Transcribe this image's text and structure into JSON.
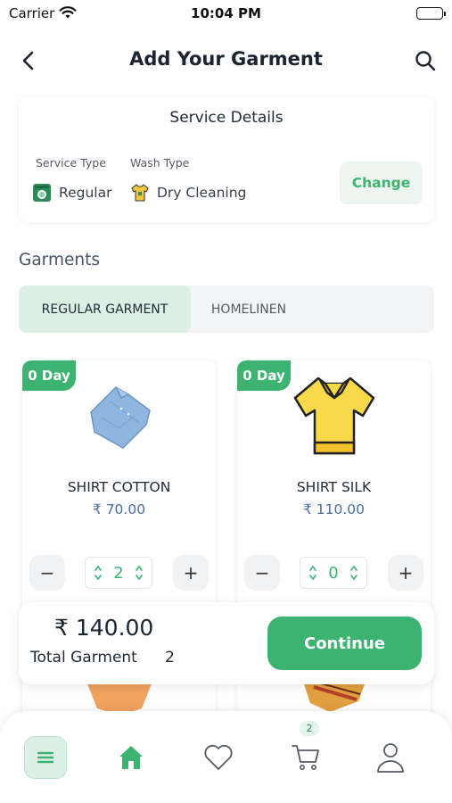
{
  "status_bar": {
    "carrier": "Carrier",
    "time": "10:04 PM"
  },
  "header": {
    "title": "Add Your Garment"
  },
  "service_details": {
    "title": "Service Details",
    "service_type_label": "Service Type",
    "service_type_value": "Regular",
    "wash_type_label": "Wash Type",
    "wash_type_value": "Dry Cleaning",
    "change_label": "Change"
  },
  "garments": {
    "section_title": "Garments",
    "tabs": [
      {
        "label": "REGULAR GARMENT",
        "active": true
      },
      {
        "label": "HOMELINEN",
        "active": false
      }
    ],
    "items": [
      {
        "badge": "0 Day",
        "name": "SHIRT COTTON",
        "price": "₹ 70.00",
        "qty": "2",
        "image": "blue-shirt-icon"
      },
      {
        "badge": "0 Day",
        "name": "SHIRT SILK",
        "price": "₹ 110.00",
        "qty": "0",
        "image": "yellow-tshirt-icon"
      }
    ],
    "minus_symbol": "−",
    "plus_symbol": "+"
  },
  "summary": {
    "total_amount": "₹ 140.00",
    "total_label": "Total Garment",
    "total_count": "2",
    "continue_label": "Continue"
  },
  "bottom_nav": {
    "cart_badge": "2"
  },
  "colors": {
    "accent": "#3cb371",
    "price": "#4a6fa5",
    "tab_active_bg": "#ddf0e5"
  }
}
